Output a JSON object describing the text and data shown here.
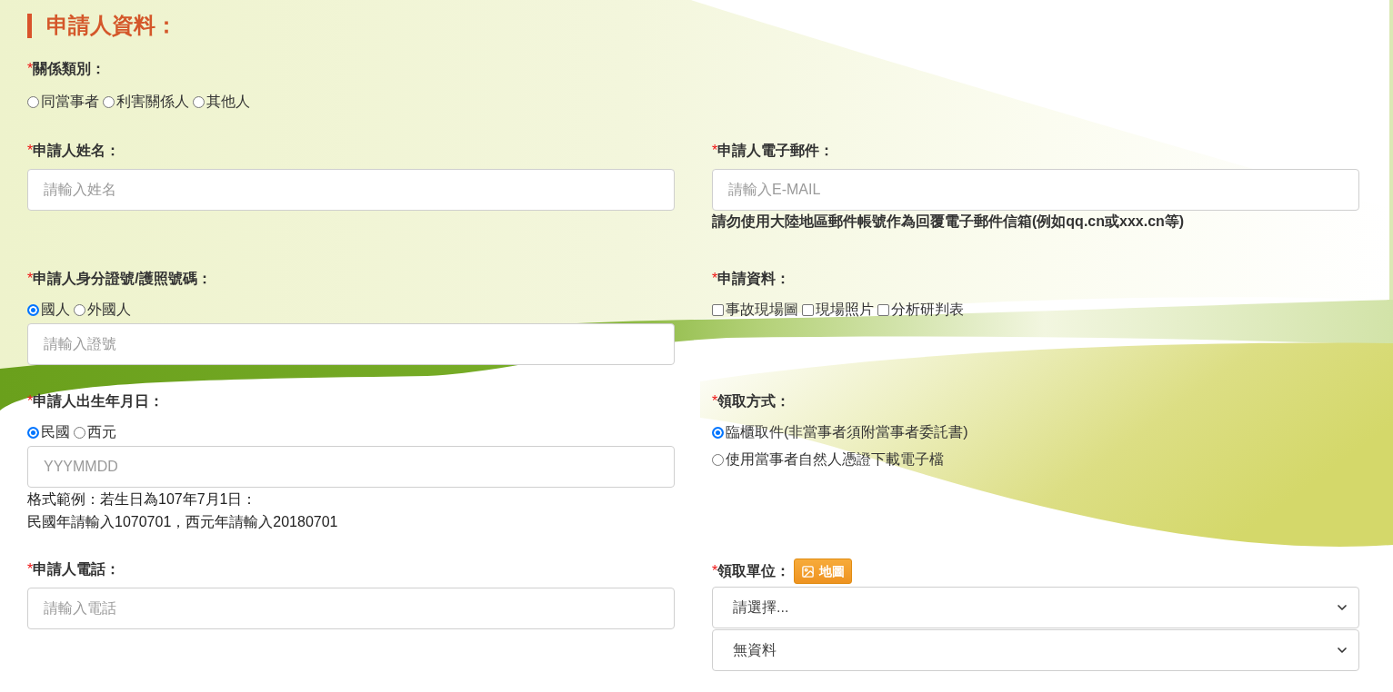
{
  "section": {
    "title": "申請人資料："
  },
  "relation": {
    "required_mark": "*",
    "label": "關係類別：",
    "controls": [
      {
        "kind": "radios",
        "options": [
          {
            "label": "同當事者",
            "selected": false
          },
          {
            "label": "利害關係人",
            "selected": false
          },
          {
            "label": "其他人",
            "selected": false
          }
        ]
      }
    ]
  },
  "rows": [
    {
      "left": {
        "required_mark": "*",
        "label": "申請人姓名：",
        "controls": [
          {
            "kind": "input",
            "placeholder": "請輸入姓名"
          }
        ]
      },
      "right": {
        "required_mark": "*",
        "label": "申請人電子郵件：",
        "controls": [
          {
            "kind": "input",
            "placeholder": "請輸入E-MAIL"
          },
          {
            "kind": "warning",
            "lines": [
              "請勿使用大陸地區郵件帳號作為回覆電子郵件信箱(例如qq.cn或xxx.cn等)"
            ]
          }
        ]
      }
    },
    {
      "left": {
        "required_mark": "*",
        "label": "申請人身分證號/護照號碼：",
        "controls": [
          {
            "kind": "radios",
            "options": [
              {
                "label": "國人",
                "selected": true
              },
              {
                "label": "外國人",
                "selected": false
              }
            ]
          },
          {
            "kind": "input",
            "placeholder": "請輸入證號"
          }
        ]
      },
      "right": {
        "required_mark": "*",
        "label": "申請資料：",
        "controls": [
          {
            "kind": "checkboxes",
            "options": [
              {
                "label": "事故現場圖",
                "checked": false
              },
              {
                "label": "現場照片",
                "checked": false
              },
              {
                "label": "分析研判表",
                "checked": false
              }
            ]
          }
        ]
      }
    },
    {
      "left": {
        "required_mark": "*",
        "label": "申請人出生年月日：",
        "controls": [
          {
            "kind": "radios",
            "options": [
              {
                "label": "民國",
                "selected": true
              },
              {
                "label": "西元",
                "selected": false
              }
            ]
          },
          {
            "kind": "input",
            "placeholder": "YYYMMDD"
          },
          {
            "kind": "note",
            "lines": [
              "格式範例：若生日為107年7月1日：",
              "民國年請輸入1070701，西元年請輸入20180701"
            ]
          }
        ]
      },
      "right": {
        "required_mark": "*",
        "label": "領取方式：",
        "controls": [
          {
            "kind": "radio_list",
            "options": [
              {
                "label": "臨櫃取件(非當事者須附當事者委託書)",
                "selected": true
              },
              {
                "label": "使用當事者自然人憑證下載電子檔",
                "selected": false
              }
            ]
          }
        ]
      }
    },
    {
      "left": {
        "required_mark": "*",
        "label": "申請人電話：",
        "controls": [
          {
            "kind": "input",
            "placeholder": "請輸入電話"
          }
        ]
      },
      "right": {
        "required_mark": "*",
        "label": "領取單位：",
        "label_button": {
          "label": "地圖"
        },
        "controls": [
          {
            "kind": "select",
            "value": "請選擇..."
          },
          {
            "kind": "select",
            "value": "無資料"
          }
        ]
      }
    }
  ]
}
